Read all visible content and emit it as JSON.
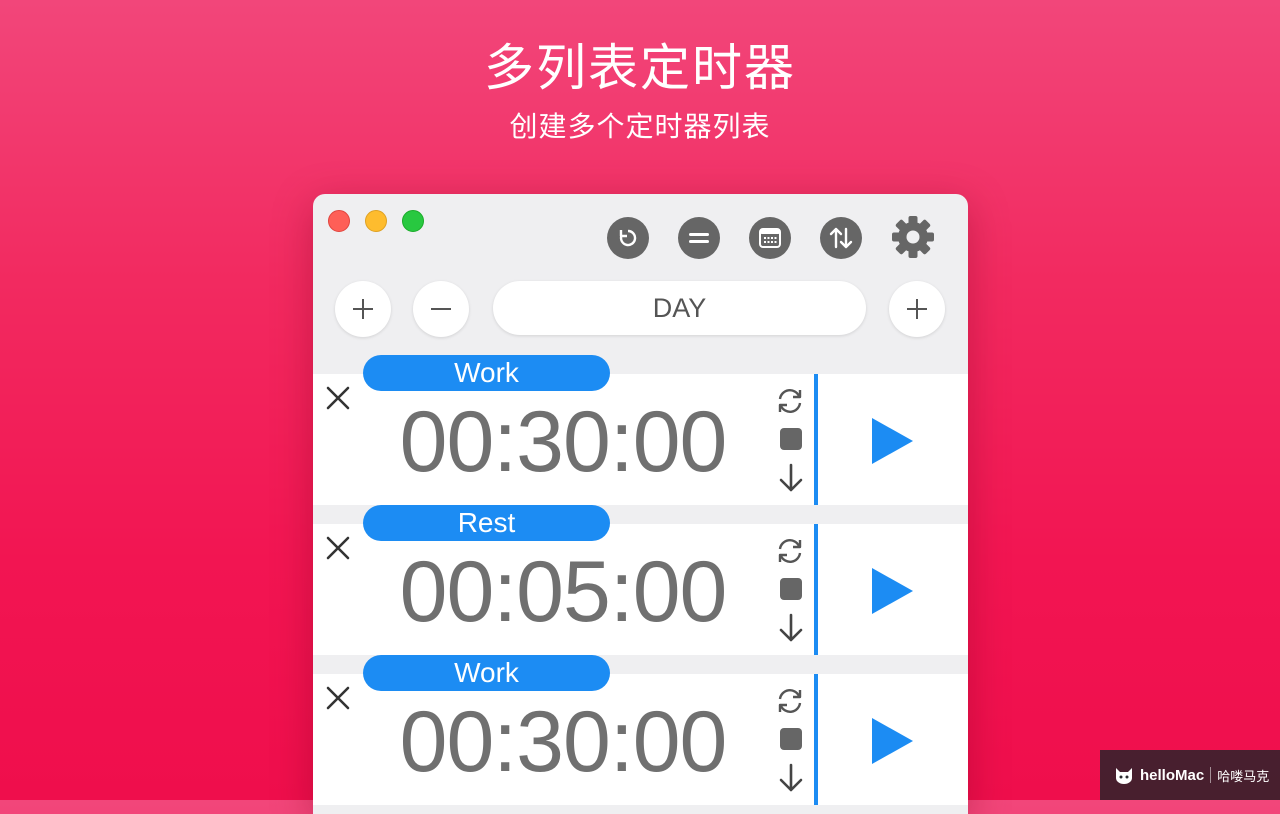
{
  "hero": {
    "title": "多列表定时器",
    "subtitle": "创建多个定时器列表"
  },
  "window": {
    "toolbar": {
      "icons": [
        "reset-icon",
        "equal-icon",
        "calendar-icon",
        "sort-icon",
        "gear-icon"
      ]
    },
    "controls": {
      "list_name": "DAY"
    },
    "timers": [
      {
        "label": "Work",
        "time": "00:30:00"
      },
      {
        "label": "Rest",
        "time": "00:05:00"
      },
      {
        "label": "Work",
        "time": "00:30:00"
      }
    ]
  },
  "colors": {
    "accent": "#1c8cf3",
    "background_top": "#f2467a",
    "background_bottom": "#ef0e4c",
    "icon_gray": "#666666"
  },
  "watermark": {
    "brand": "helloMac",
    "cn": "哈喽马克"
  }
}
